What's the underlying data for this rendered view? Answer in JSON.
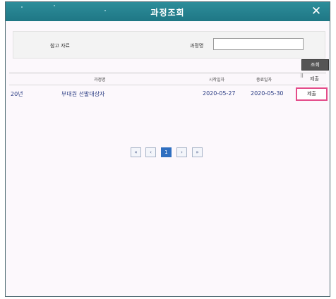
{
  "window": {
    "title": "과정조회",
    "close_icon": "close-icon"
  },
  "search": {
    "category_label": "참고 자료",
    "course_name_label": "과정명",
    "course_name_value": "",
    "search_button": "조회"
  },
  "table": {
    "headers": [
      "과정명",
      "시작일자",
      "종료일자",
      "제출"
    ],
    "rows": [
      {
        "year": "20년",
        "name": "부대원 선발대상자",
        "start": "2020-05-27",
        "end": "2020-05-30",
        "action": "제출"
      }
    ]
  },
  "pagination": {
    "first": "«",
    "prev": "‹",
    "current": "1",
    "next": "›",
    "last": "»"
  },
  "colors": {
    "titlebar": "#2d8d9a",
    "highlight_border": "#e44c8a",
    "page_active": "#2f6fc0"
  }
}
